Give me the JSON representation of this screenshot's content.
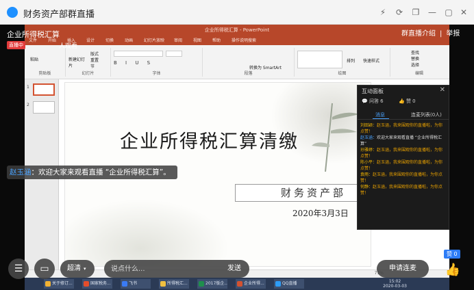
{
  "window": {
    "title": "财务资产部群直播",
    "controls": [
      "⚡",
      "⟳",
      "❐",
      "—",
      "▢",
      "✕"
    ]
  },
  "live": {
    "title": "企业所得税汇算",
    "badge": "直播中",
    "viewers": "人观看",
    "links": [
      "群直播介绍",
      "|",
      "举报"
    ]
  },
  "ppt": {
    "app_title": "企业所得税汇算 - PowerPoint",
    "tabs": [
      "文件",
      "开始",
      "插入",
      "设计",
      "切换",
      "动画",
      "幻灯片放映",
      "审阅",
      "视图",
      "帮助",
      "操作说明搜索"
    ],
    "ribbon_groups": [
      "剪贴板",
      "幻灯片",
      "字体",
      "段落",
      "绘图",
      "编辑"
    ],
    "ribbon_items": {
      "paste": "粘贴",
      "new_slide": "新建幻灯片",
      "layout": "版式",
      "reset": "重置",
      "section": "节",
      "find": "查找",
      "replace": "替换",
      "select": "选择",
      "smartart": "转换为 SmartArt",
      "arrange": "排列",
      "quick_styles": "快速样式"
    },
    "thumbs": [
      "1",
      "2"
    ],
    "slide": {
      "title": "企业所得税汇算清缴",
      "dept": "财务资产部",
      "date": "2020年3月3日"
    },
    "taskbar": [
      {
        "label": "关于修订...",
        "color": "#f2b233"
      },
      {
        "label": "国家税务...",
        "color": "#e34d2b"
      },
      {
        "label": "飞书",
        "color": "#3a7bf5"
      },
      {
        "label": "所得税汇...",
        "color": "#f0c040"
      },
      {
        "label": "2017版企...",
        "color": "#1f8f4d"
      },
      {
        "label": "企业所得...",
        "color": "#d35230"
      },
      {
        "label": "QQ直播",
        "color": "#2d9cf6"
      }
    ],
    "clock_time": "15:02",
    "clock_date": "2020-03-03",
    "zoom": "71%"
  },
  "chat_bubble": {
    "name": "赵玉涵",
    "text": "：欢迎大家来观看直播 “企业所得税汇算”。"
  },
  "panel": {
    "title": "互动面板",
    "questions": "问答 6",
    "likes": "赞 0",
    "tab_msgs": "消息",
    "tab_queue": "连麦列表(0人)",
    "messages": [
      {
        "user": "刘田颖：",
        "text": "赵玉涵，我来围观你的直播啦，为你点赞！",
        "style": "orange"
      },
      {
        "user": "赵玉涵：",
        "text": "欢迎大家来观看直播 “企业所得税汇算”",
        "style": "blue"
      },
      {
        "user": "孙雅婷：",
        "text": "赵玉涵，我来围观你的直播啦，为你点赞！",
        "style": "orange"
      },
      {
        "user": "陈小平：",
        "text": "赵玉涵，我来围观你的直播啦，为你点赞！",
        "style": "orange"
      },
      {
        "user": "袁雨：",
        "text": "赵玉涵，我来围观你的直播啦，为你点赞！",
        "style": "orange"
      },
      {
        "user": "何静：",
        "text": "赵玉涵，我来围观你的直播啦，为你点赞！",
        "style": "orange"
      }
    ]
  },
  "controls": {
    "clarity": "超清",
    "input_placeholder": "说点什么...",
    "send": "发送",
    "mic_request": "申请连麦",
    "like_count": "赞 0"
  }
}
